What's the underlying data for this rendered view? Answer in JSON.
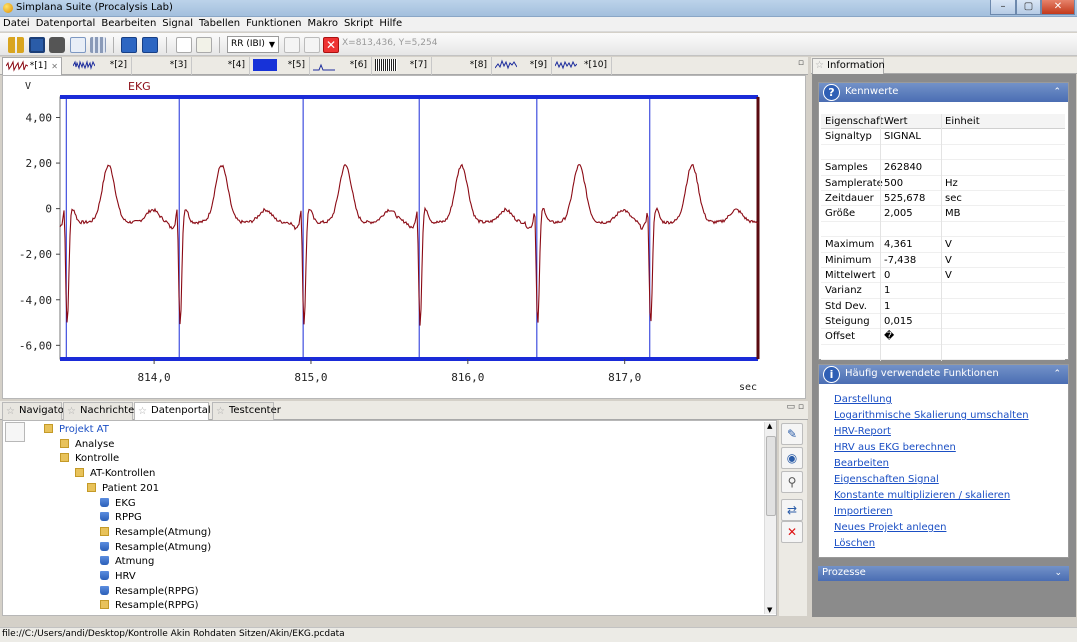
{
  "window": {
    "title": "Simplana Suite (Procalysis Lab)",
    "minimize": "–",
    "maximize": "▢",
    "close": "✕"
  },
  "menu": [
    "Datei",
    "Datenportal",
    "Bearbeiten",
    "Signal",
    "Tabellen",
    "Funktionen",
    "Makro",
    "Skript",
    "Hilfe"
  ],
  "toolbar": {
    "selector_value": "RR (IBI)",
    "coordinates": "X=813,436, Y=5,254"
  },
  "signal_tabs": [
    "*[1]",
    "*[2]",
    "*[3]",
    "*[4]",
    "*[5]",
    "*[6]",
    "*[7]",
    "*[8]",
    "*[9]",
    "*[10]"
  ],
  "chart_data": {
    "type": "line",
    "series": [
      {
        "name": "EKG",
        "color": "#8b0a14"
      }
    ],
    "ylabel": "V",
    "xlabel": "sec",
    "y_ticks": [
      "4,00",
      "2,00",
      "0",
      "-2,00",
      "-4,00",
      "-6,00"
    ],
    "x_ticks": [
      "814,0",
      "815,0",
      "816,0",
      "817,0"
    ],
    "ylim": [
      -6.6,
      4.9
    ],
    "xlim": [
      813.4,
      817.85
    ],
    "grid": false,
    "markers_x": [
      813.44,
      814.16,
      814.95,
      815.69,
      816.44,
      817.16
    ],
    "r_peaks_x": [
      813.44,
      814.16,
      814.95,
      815.69,
      816.44,
      817.16
    ]
  },
  "bottom_tabs": [
    "Navigator",
    "Nachrichten",
    "Datenportal",
    "Testcenter"
  ],
  "tree": [
    {
      "label": "Projekt AT",
      "type": "project",
      "level": 0
    },
    {
      "label": "Analyse",
      "type": "folder",
      "level": 1
    },
    {
      "label": "Kontrolle",
      "type": "folder",
      "level": 1
    },
    {
      "label": "AT-Kontrollen",
      "type": "folder",
      "level": 2
    },
    {
      "label": "Patient 201",
      "type": "folder",
      "level": 3
    },
    {
      "label": "EKG",
      "type": "signal",
      "level": 4
    },
    {
      "label": "RPPG",
      "type": "signal",
      "level": 4
    },
    {
      "label": "Resample(Atmung)",
      "type": "folder",
      "level": 4
    },
    {
      "label": "Resample(Atmung)",
      "type": "signal",
      "level": 4
    },
    {
      "label": "Atmung",
      "type": "signal",
      "level": 4
    },
    {
      "label": "HRV",
      "type": "signal",
      "level": 4
    },
    {
      "label": "Resample(RPPG)",
      "type": "signal",
      "level": 4
    },
    {
      "label": "Resample(RPPG)",
      "type": "folder",
      "level": 4
    }
  ],
  "status": "file://C:/Users/andi/Desktop/Kontrolle Akin Rohdaten  Sitzen/Akin/EKG.pcdata",
  "info_panel": {
    "tab": "Information",
    "kennwerte_title": "Kennwerte",
    "headers": [
      "Eigenschaft",
      "Wert",
      "Einheit"
    ],
    "rows": [
      [
        "Signaltyp",
        "SIGNAL",
        ""
      ],
      [
        "",
        "",
        ""
      ],
      [
        "Samples",
        "262840",
        ""
      ],
      [
        "Samplerate",
        "500",
        "Hz"
      ],
      [
        "Zeitdauer",
        "525,678",
        "sec"
      ],
      [
        "Größe",
        "2,005",
        "MB"
      ],
      [
        "",
        "",
        ""
      ],
      [
        "Maximum",
        "4,361",
        "V"
      ],
      [
        "Minimum",
        "-7,438",
        "V"
      ],
      [
        "Mittelwert",
        "0",
        "V"
      ],
      [
        "Varianz",
        "1",
        ""
      ],
      [
        "Std Dev.",
        "1",
        ""
      ],
      [
        "Steigung",
        "0,015",
        ""
      ],
      [
        "Offset",
        "�",
        ""
      ],
      [
        "",
        "",
        ""
      ]
    ],
    "functions_title": "Häufig verwendete Funktionen",
    "functions": [
      "Darstellung",
      "Logarithmische Skalierung umschalten",
      "HRV-Report",
      "HRV aus EKG berechnen",
      "Bearbeiten",
      "Eigenschaften Signal",
      "Konstante multiplizieren / skalieren",
      "Importieren",
      "Neues Projekt anlegen",
      "Löschen"
    ],
    "prozesse_title": "Prozesse"
  },
  "colors": {
    "accent": "#4a6db3",
    "signal": "#8b0a14",
    "marker": "#1a2bd8",
    "link": "#1b4fc4"
  }
}
